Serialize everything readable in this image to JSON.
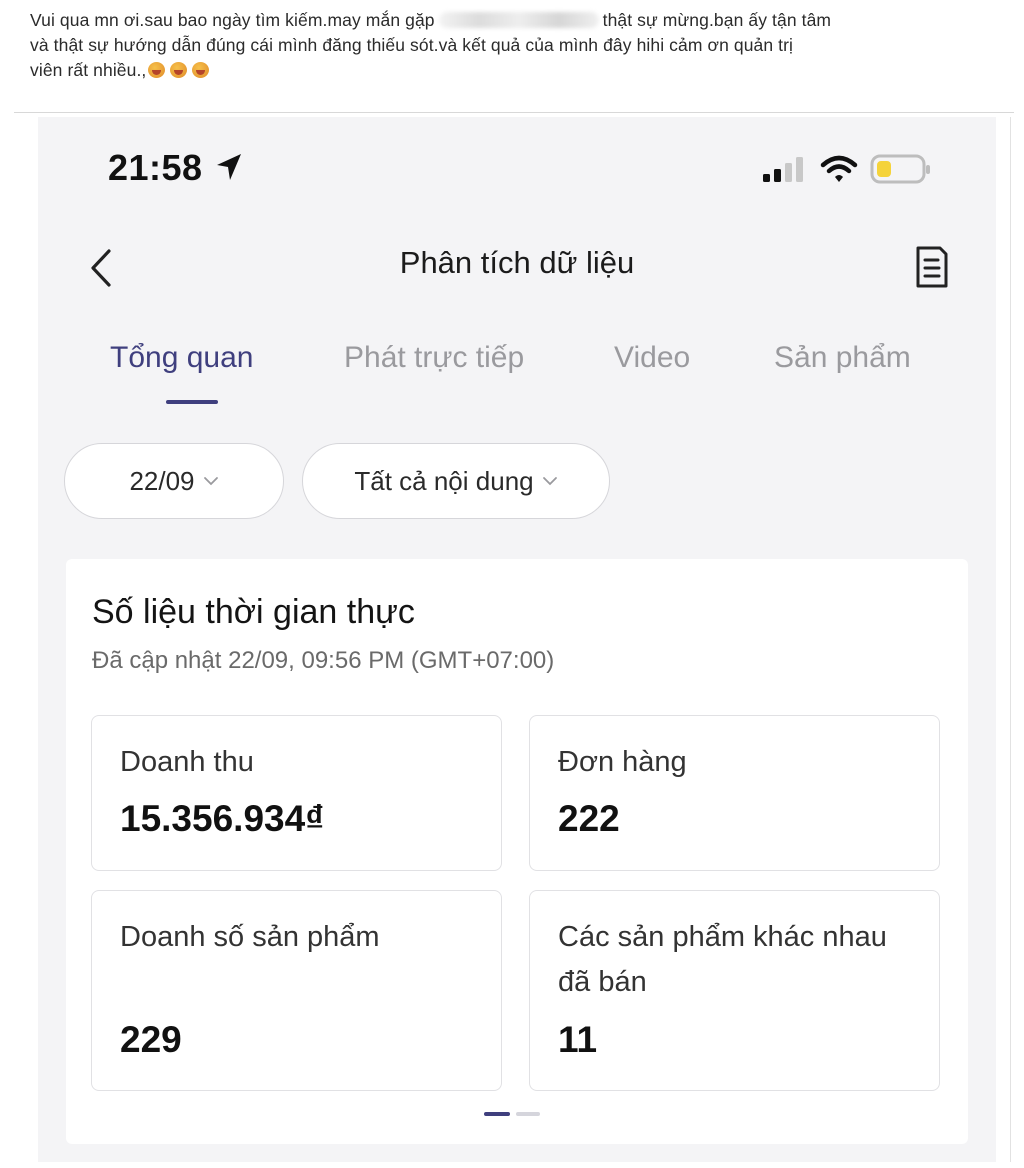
{
  "post": {
    "text_line1_a": "Vui qua mn ơi.sau bao ngày tìm kiếm.may mắn gặp",
    "text_line1_b": "thật sự mừng.bạn ấy tận tâm",
    "text_line2": "và thật sự hướng dẫn đúng cái mình đăng thiếu sót.và kết quả của mình đây hihi cảm ơn quản trị",
    "text_line3": "viên rất nhiều.,"
  },
  "status_bar": {
    "time": "21:58",
    "icons": [
      "location-arrow-icon",
      "cellular-signal-icon",
      "wifi-icon",
      "battery-low-icon"
    ]
  },
  "header": {
    "title": "Phân tích dữ liệu"
  },
  "tabs": [
    {
      "label": "Tổng quan",
      "active": true
    },
    {
      "label": "Phát trực tiếp",
      "active": false
    },
    {
      "label": "Video",
      "active": false
    },
    {
      "label": "Sản phẩm",
      "active": false
    }
  ],
  "filters": {
    "date": "22/09",
    "content": "Tất cả nội dung"
  },
  "realtime": {
    "title": "Số liệu thời gian thực",
    "updated": "Đã cập nhật 22/09, 09:56 PM (GMT+07:00)",
    "metrics": [
      {
        "label": "Doanh thu",
        "value": "15.356.934₫"
      },
      {
        "label": "Đơn hàng",
        "value": "222"
      },
      {
        "label": "Doanh số sản phẩm",
        "value": "229"
      },
      {
        "label": "Các sản phẩm khác nhau đã bán",
        "value": "11"
      }
    ],
    "pager": {
      "page": 1,
      "total": 2
    }
  },
  "colors": {
    "accent": "#3f3f7e",
    "tab_inactive": "#9a9a9e",
    "screen_bg": "#f4f4f6",
    "battery_fill": "#f5d33a"
  }
}
